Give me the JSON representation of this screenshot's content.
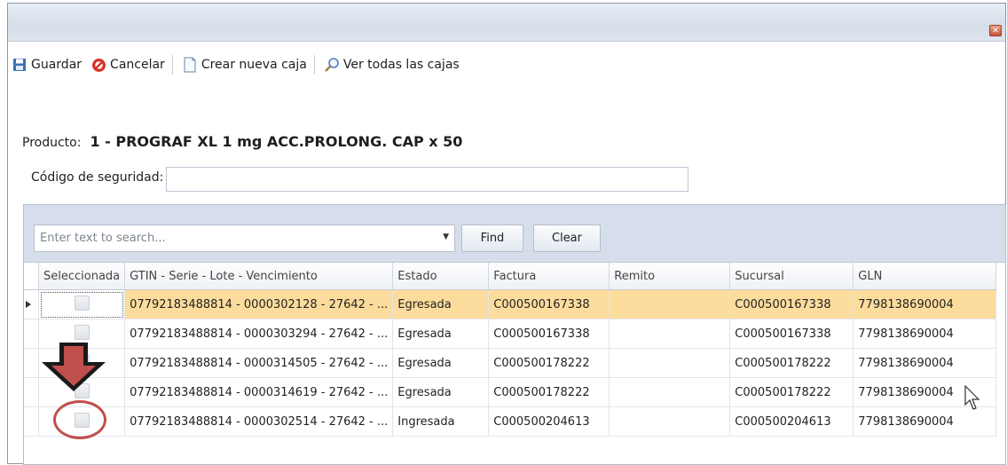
{
  "toolbar": {
    "guardar": "Guardar",
    "cancelar": "Cancelar",
    "crear": "Crear nueva caja",
    "ver": "Ver todas las cajas"
  },
  "producto": {
    "label": "Producto:",
    "value": "1 - PROGRAF XL 1 mg ACC.PROLONG. CAP x   50"
  },
  "codigo": {
    "label": "Código de seguridad:",
    "value": ""
  },
  "search": {
    "placeholder": "Enter text to search...",
    "find": "Find",
    "clear": "Clear"
  },
  "grid": {
    "columns": [
      "Seleccionada",
      "GTIN - Serie - Lote - Vencimiento",
      "Estado",
      "Factura",
      "Remito",
      "Sucursal",
      "GLN"
    ],
    "rows": [
      {
        "gtin": "07792183488814 - 0000302128 - 27642 - ...",
        "estado": "Egresada",
        "factura": "C000500167338",
        "remito": "",
        "sucursal": "C000500167338",
        "gln": "7798138690004",
        "selected": false
      },
      {
        "gtin": "07792183488814 - 0000303294 - 27642 - ...",
        "estado": "Egresada",
        "factura": "C000500167338",
        "remito": "",
        "sucursal": "C000500167338",
        "gln": "7798138690004",
        "selected": false
      },
      {
        "gtin": "07792183488814 - 0000314505 - 27642 - ...",
        "estado": "Egresada",
        "factura": "C000500178222",
        "remito": "",
        "sucursal": "C000500178222",
        "gln": "7798138690004",
        "selected": false
      },
      {
        "gtin": "07792183488814 - 0000314619 - 27642 - ...",
        "estado": "Egresada",
        "factura": "C000500178222",
        "remito": "",
        "sucursal": "C000500178222",
        "gln": "7798138690004",
        "selected": false
      },
      {
        "gtin": "07792183488814 - 0000302514 - 27642 - ...",
        "estado": "Ingresada",
        "factura": "C000500204613",
        "remito": "",
        "sucursal": "C000500204613",
        "gln": "7798138690004",
        "selected": false
      }
    ]
  },
  "colors": {
    "focused_row": "#fcdc9c",
    "annotation_red": "#c0504d",
    "find_panel": "#d5deea"
  },
  "icons": [
    "save-icon",
    "cancel-icon",
    "new-box-icon",
    "search-icon",
    "close-icon"
  ]
}
